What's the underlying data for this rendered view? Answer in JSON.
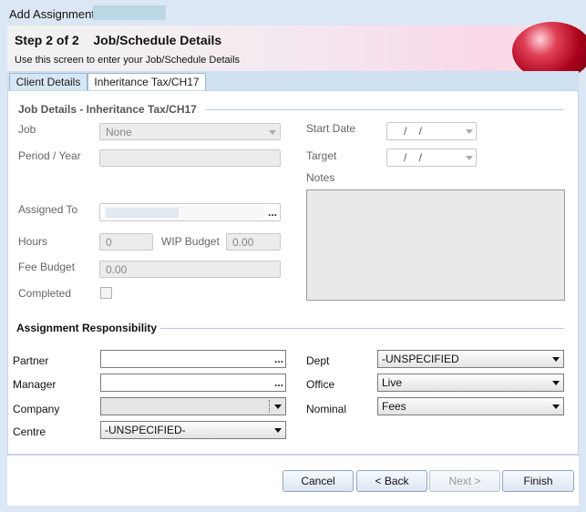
{
  "window": {
    "title": "Add Assignment"
  },
  "header": {
    "step": "Step 2 of 2    Job/Schedule Details",
    "subtitle": "Use this screen to enter your Job/Schedule Details"
  },
  "tabs": [
    {
      "label": "Client Details"
    },
    {
      "label": "Inheritance Tax/CH17"
    }
  ],
  "job_details": {
    "section_title": "Job Details - Inheritance Tax/CH17",
    "job_label": "Job",
    "job_value": "None",
    "period_label": "Period / Year",
    "period_value": "",
    "assigned_to_label": "Assigned To",
    "assigned_dots": "...",
    "hours_label": "Hours",
    "hours_value": "0",
    "wip_budget_label": "WIP Budget",
    "wip_budget_value": "0.00",
    "fee_budget_label": "Fee Budget",
    "fee_budget_value": "0.00",
    "completed_label": "Completed",
    "start_date_label": "Start Date",
    "start_date_value": "/    /",
    "target_label": "Target",
    "target_value": "/    /",
    "notes_label": "Notes"
  },
  "responsibility": {
    "section_title": "Assignment Responsibility",
    "partner_label": "Partner",
    "manager_label": "Manager",
    "company_label": "Company",
    "centre_label": "Centre",
    "centre_value": "-UNSPECIFIED-",
    "dept_label": "Dept",
    "dept_value": "-UNSPECIFIED",
    "office_label": "Office",
    "office_value": "Live",
    "nominal_label": "Nominal",
    "nominal_value": "Fees",
    "dots": "..."
  },
  "buttons": {
    "cancel": "Cancel",
    "back": "< Back",
    "next": "Next >",
    "finish": "Finish"
  }
}
